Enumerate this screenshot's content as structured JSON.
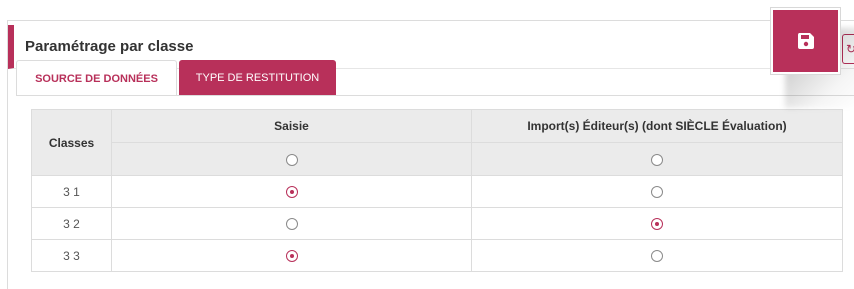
{
  "panel": {
    "title": "Paramétrage par classe"
  },
  "tabs": [
    {
      "label": "SOURCE DE DONNÉES",
      "active": true
    },
    {
      "label": "TYPE DE RESTITUTION",
      "active": false
    }
  ],
  "table": {
    "headers": {
      "classes": "Classes",
      "saisie": "Saisie",
      "import": "Import(s) Éditeur(s) (dont SIÈCLE Évaluation)"
    },
    "select_all": {
      "saisie": false,
      "import": false
    },
    "rows": [
      {
        "classe": "3 1",
        "source": "saisie"
      },
      {
        "classe": "3 2",
        "source": "import"
      },
      {
        "classe": "3 3",
        "source": "saisie"
      }
    ]
  },
  "toolbar": {
    "save_icon": "floppy-disk-icon"
  },
  "colors": {
    "accent": "#b8305a",
    "header_bg": "#ebebeb",
    "border": "#dcdcdc"
  }
}
